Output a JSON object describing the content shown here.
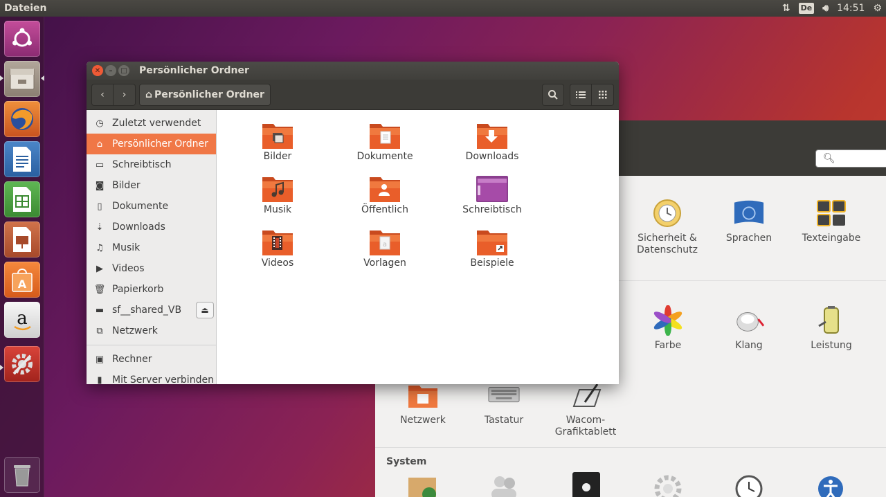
{
  "top_panel": {
    "app_title": "Dateien",
    "keyboard_layout": "De",
    "clock": "14:51"
  },
  "launcher": {
    "items": [
      "ubuntu-dash",
      "files",
      "firefox",
      "writer",
      "calc",
      "impress",
      "software-center",
      "amazon",
      "system-settings",
      "trash"
    ]
  },
  "settings_window": {
    "row1": [
      {
        "label": "Sicherheit & Datenschutz",
        "icon": "security-icon"
      },
      {
        "label": "Sprachen",
        "icon": "languages-icon"
      },
      {
        "label": "Texteingabe",
        "icon": "text-input-icon"
      }
    ],
    "row2": [
      {
        "label": "Farbe",
        "icon": "color-icon"
      },
      {
        "label": "Klang",
        "icon": "sound-icon"
      },
      {
        "label": "Leistung",
        "icon": "power-icon"
      }
    ],
    "row3": [
      {
        "label": "Netzwerk",
        "icon": "network-icon"
      },
      {
        "label": "Tastatur",
        "icon": "keyboard-icon"
      },
      {
        "label": "Wacom-Grafiktablett",
        "icon": "wacom-icon"
      }
    ],
    "section_system": "System"
  },
  "window": {
    "title": "Persönlicher Ordner",
    "path_button": "Persönlicher Ordner"
  },
  "sidebar": {
    "items": [
      {
        "label": "Zuletzt verwendet",
        "icon": "clock-icon"
      },
      {
        "label": "Persönlicher Ordner",
        "icon": "home-icon"
      },
      {
        "label": "Schreibtisch",
        "icon": "folder-icon"
      },
      {
        "label": "Bilder",
        "icon": "camera-icon"
      },
      {
        "label": "Dokumente",
        "icon": "document-icon"
      },
      {
        "label": "Downloads",
        "icon": "download-icon"
      },
      {
        "label": "Musik",
        "icon": "music-icon"
      },
      {
        "label": "Videos",
        "icon": "video-icon"
      },
      {
        "label": "Papierkorb",
        "icon": "trash-icon"
      },
      {
        "label": "sf__shared_VB",
        "icon": "drive-icon"
      },
      {
        "label": "Netzwerk",
        "icon": "network-icon"
      },
      {
        "label": "Rechner",
        "icon": "computer-icon"
      },
      {
        "label": "Mit Server verbinden",
        "icon": "server-icon"
      }
    ]
  },
  "files": [
    {
      "label": "Bilder",
      "emblem": "picture"
    },
    {
      "label": "Dokumente",
      "emblem": "document"
    },
    {
      "label": "Downloads",
      "emblem": "download"
    },
    {
      "label": "Musik",
      "emblem": "music"
    },
    {
      "label": "Öffentlich",
      "emblem": "person"
    },
    {
      "label": "Schreibtisch",
      "emblem": "desktop"
    },
    {
      "label": "Videos",
      "emblem": "video"
    },
    {
      "label": "Vorlagen",
      "emblem": "template"
    },
    {
      "label": "Beispiele",
      "emblem": "link"
    }
  ],
  "colors": {
    "accent": "#f07746",
    "folder": "#e95e2a",
    "panel": "#3c3b37"
  }
}
